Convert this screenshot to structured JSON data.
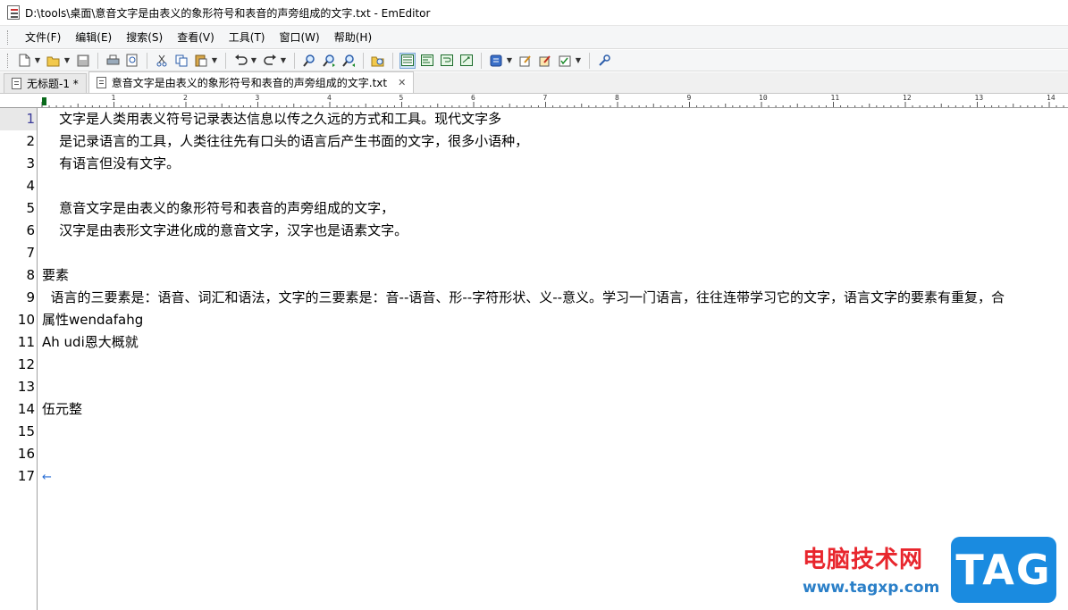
{
  "window": {
    "title": "D:\\tools\\桌面\\意音文字是由表义的象形符号和表音的声旁组成的文字.txt - EmEditor"
  },
  "menu": [
    "文件(F)",
    "编辑(E)",
    "搜索(S)",
    "查看(V)",
    "工具(T)",
    "窗口(W)",
    "帮助(H)"
  ],
  "toolbar": {
    "icons": [
      "new-file-icon",
      "open-folder-icon",
      "save-icon",
      "print-icon",
      "print-preview-icon",
      "cut-icon",
      "copy-icon",
      "paste-icon",
      "undo-icon",
      "redo-icon",
      "find-icon",
      "find-next-icon",
      "find-prev-icon",
      "find-in-files-icon",
      "wrap-none-icon",
      "wrap-by-chars-icon",
      "wrap-by-window-icon",
      "wrap-by-page-icon",
      "config-icon",
      "properties-icon",
      "customize-icon",
      "macro-icon",
      "tools-icon"
    ]
  },
  "tabs": [
    {
      "label": "无标题-1 *",
      "active": false
    },
    {
      "label": "意音文字是由表义的象形符号和表音的声旁组成的文字.txt",
      "active": true
    }
  ],
  "ruler": {
    "labels": [
      "1",
      "2",
      "3",
      "4",
      "5",
      "6",
      "7",
      "8",
      "9",
      "10",
      "11",
      "12",
      "13",
      "14"
    ]
  },
  "editor": {
    "current_line": 1,
    "lines": [
      "    文字是人类用表义符号记录表达信息以传之久远的方式和工具。现代文字多",
      "    是记录语言的工具，人类往往先有口头的语言后产生书面的文字，很多小语种，",
      "    有语言但没有文字。",
      "",
      "    意音文字是由表义的象形符号和表音的声旁组成的文字，",
      "    汉字是由表形文字进化成的意音文字，汉字也是语素文字。",
      "",
      "要素",
      "  语言的三要素是：语音、词汇和语法，文字的三要素是：音--语音、形--字符形状、义--意义。学习一门语言，往往连带学习它的文字，语言文字的要素有重复，合",
      "属性wendafahg",
      "Ah udi恩大概就",
      "",
      "",
      "伍元整",
      "",
      "",
      ""
    ],
    "eof_mark": "←"
  },
  "watermark": {
    "cn": "电脑技术网",
    "url": "www.tagxp.com",
    "badge": "TAG"
  }
}
